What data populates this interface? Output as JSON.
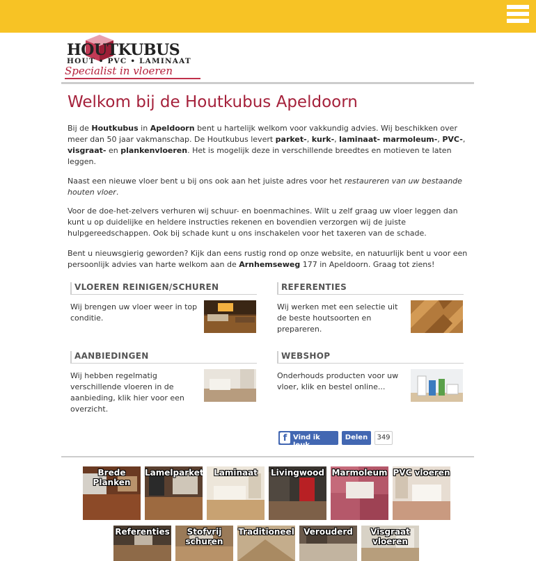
{
  "header": {
    "menu_icon": "hamburger-icon",
    "background": "#f7c325"
  },
  "logo": {
    "brand": "HOUTKUBUS",
    "subline": "HOUT • PVC • LAMINAAT",
    "slogan": "Specialist in vloeren"
  },
  "main": {
    "title": "Welkom bij de Houtkubus Apeldoorn",
    "accent_color": "#a5213b",
    "p1": {
      "t1": "Bij de ",
      "b1": "Houtkubus",
      "t2": " in ",
      "b2": "Apeldoorn",
      "t3": " bent u hartelijk welkom voor vakkundig advies. Wij beschikken over meer dan 50 jaar vakmanschap. De Houtkubus levert ",
      "b3": "parket-",
      "t4": ", ",
      "b4": "kurk-",
      "t5": ", ",
      "b5": "laminaat- marmoleum-",
      "t6": ", ",
      "b6": "PVC-",
      "t7": ", ",
      "b7": "visgraat-",
      "t8": " en ",
      "b8": "plankenvloeren",
      "t9": ". Het is mogelijk deze in verschillende breedtes en motieven te laten leggen."
    },
    "p2": {
      "t1": "Naast een nieuwe vloer bent u bij ons ook aan het juiste adres voor het ",
      "i1": "restaureren van uw bestaande houten vloer",
      "t2": "."
    },
    "p3": "Voor de doe-het-zelvers verhuren wij schuur- en boenmachines. Wilt u zelf graag uw vloer leggen dan kunt u op duidelijke en heldere instructies rekenen en bovendien verzorgen wij de juiste hulpgereedschappen. Ook bij schade kunt u ons inschakelen voor het taxeren van de schade.",
    "p4": {
      "t1": "Bent u nieuwsgierig geworden? Kijk dan eens rustig rond op onze website, en natuurlijk bent u voor een persoonlijk advies van harte welkom aan de ",
      "b1": "Arnhemseweg",
      "t2": " 177 in Apeldoorn. Graag tot ziens!"
    }
  },
  "blocks": [
    {
      "heading": "VLOEREN REINIGEN/SCHUREN",
      "text": "Wij brengen uw vloer weer in top conditie."
    },
    {
      "heading": "REFERENTIES",
      "text": "Wij werken met een selectie uit de beste houtsoorten en prepareren."
    },
    {
      "heading": "AANBIEDINGEN",
      "text": "Wij hebben regelmatig verschillende vloeren in de aanbieding, klik hier voor een overzicht."
    },
    {
      "heading": "WEBSHOP",
      "text": "Onderhouds producten voor uw vloer, klik en bestel online..."
    }
  ],
  "facebook": {
    "like_label": "Vind ik leuk",
    "share_label": "Delen",
    "count": "349",
    "icon": "facebook-icon"
  },
  "tiles_row1": [
    {
      "label": "Brede Planken"
    },
    {
      "label": "Lamelparket"
    },
    {
      "label": "Laminaat"
    },
    {
      "label": "Livingwood"
    },
    {
      "label": "Marmoleum"
    },
    {
      "label": "PVC vloeren"
    }
  ],
  "tiles_row2": [
    {
      "label": "Referenties"
    },
    {
      "label": "Stofvrij schuren"
    },
    {
      "label": "Traditioneel"
    },
    {
      "label": "Verouderd"
    },
    {
      "label": "Visgraat vloeren"
    }
  ]
}
